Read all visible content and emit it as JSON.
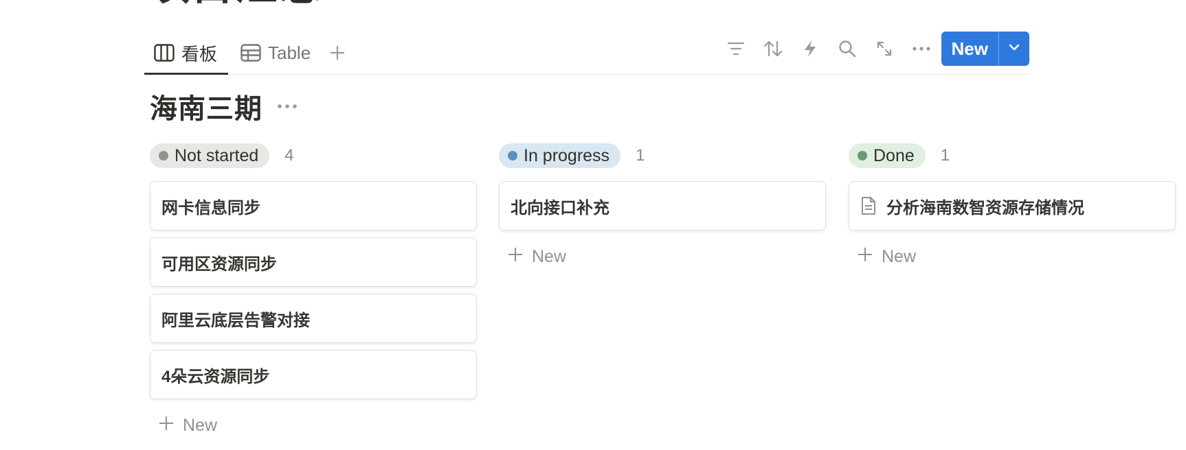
{
  "page": {
    "title_partial": "项目汇总"
  },
  "views": {
    "tabs": [
      {
        "label": "看板",
        "icon": "board-icon",
        "active": true
      },
      {
        "label": "Table",
        "icon": "table-icon",
        "active": false
      }
    ],
    "add_view_icon": "plus-icon"
  },
  "toolbar": {
    "icons": [
      "filter-icon",
      "sort-icon",
      "automation-icon",
      "search-icon",
      "expand-icon",
      "more-icon"
    ],
    "new_label": "New",
    "dropdown_icon": "chevron-down-icon",
    "accent_color": "#2e79de"
  },
  "group": {
    "title": "海南三期"
  },
  "board": {
    "columns": [
      {
        "status": "Not started",
        "count": "4",
        "pill_bg": "#e8e7e4",
        "dot_color": "#91918e",
        "cards": [
          {
            "title": "网卡信息同步"
          },
          {
            "title": "可用区资源同步"
          },
          {
            "title": "阿里云底层告警对接"
          },
          {
            "title": "4朵云资源同步"
          }
        ],
        "add_label": "New"
      },
      {
        "status": "In progress",
        "count": "1",
        "pill_bg": "#d9e7f2",
        "dot_color": "#5b8fc0",
        "cards": [
          {
            "title": "北向接口补充"
          }
        ],
        "add_label": "New"
      },
      {
        "status": "Done",
        "count": "1",
        "pill_bg": "#e1efe2",
        "dot_color": "#6c9a76",
        "cards": [
          {
            "title": "分析海南数智资源存储情况",
            "icon": "document-icon"
          }
        ],
        "add_label": "New"
      }
    ]
  }
}
